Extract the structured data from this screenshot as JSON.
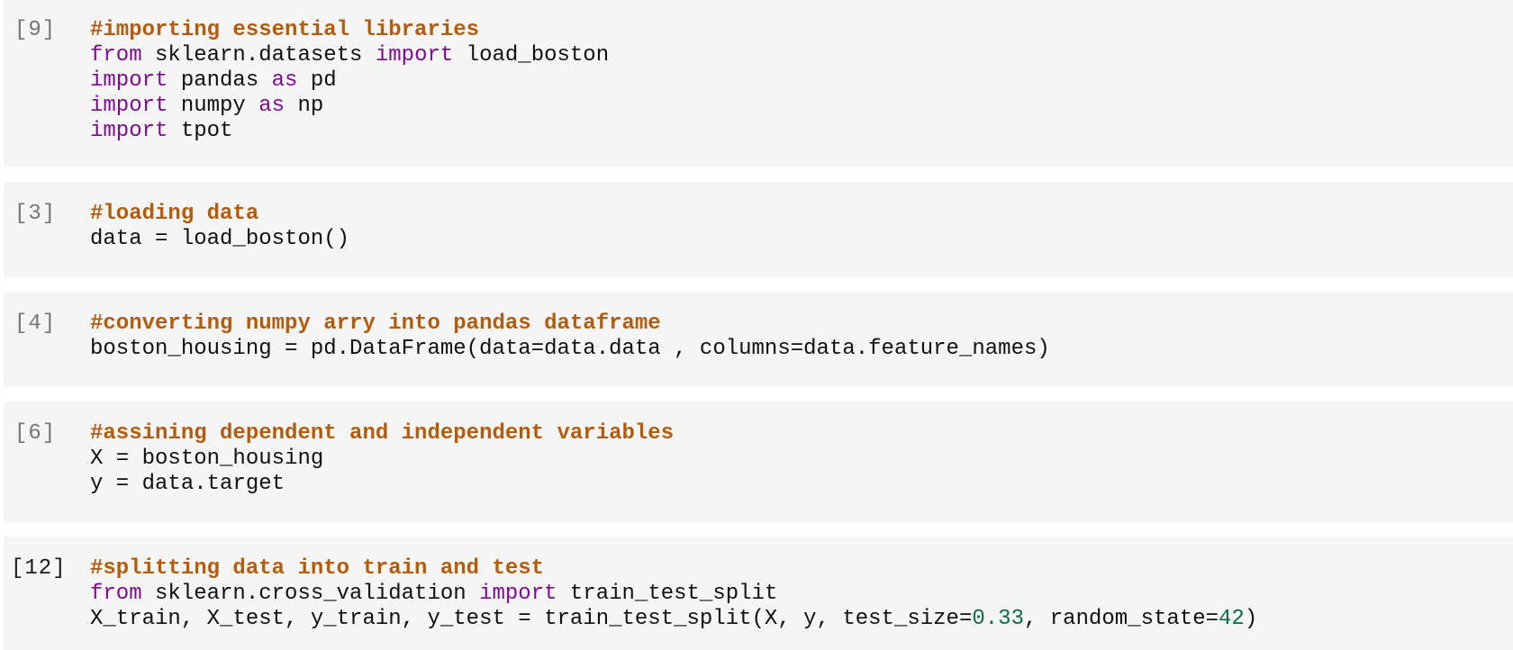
{
  "notebook": {
    "cells": [
      {
        "execution_count": "[9]",
        "active": false,
        "lines": [
          [
            {
              "t": "cm",
              "v": "#importing essential libraries"
            }
          ],
          [
            {
              "t": "kw",
              "v": "from"
            },
            {
              "t": "tx",
              "v": " sklearn.datasets "
            },
            {
              "t": "kw",
              "v": "import"
            },
            {
              "t": "tx",
              "v": " load_boston"
            }
          ],
          [
            {
              "t": "kw",
              "v": "import"
            },
            {
              "t": "tx",
              "v": " pandas "
            },
            {
              "t": "kw",
              "v": "as"
            },
            {
              "t": "tx",
              "v": " pd"
            }
          ],
          [
            {
              "t": "kw",
              "v": "import"
            },
            {
              "t": "tx",
              "v": " numpy "
            },
            {
              "t": "kw",
              "v": "as"
            },
            {
              "t": "tx",
              "v": " np"
            }
          ],
          [
            {
              "t": "kw",
              "v": "import"
            },
            {
              "t": "tx",
              "v": " tpot"
            }
          ]
        ]
      },
      {
        "execution_count": "[3]",
        "active": false,
        "lines": [
          [
            {
              "t": "cm",
              "v": "#loading data"
            }
          ],
          [
            {
              "t": "tx",
              "v": "data = load_boston()"
            }
          ]
        ]
      },
      {
        "execution_count": "[4]",
        "active": false,
        "lines": [
          [
            {
              "t": "cm",
              "v": "#converting numpy arry into pandas dataframe"
            }
          ],
          [
            {
              "t": "tx",
              "v": "boston_housing = pd.DataFrame(data=data.data , columns=data.feature_names)"
            }
          ]
        ]
      },
      {
        "execution_count": "[6]",
        "active": false,
        "lines": [
          [
            {
              "t": "cm",
              "v": "#assining dependent and independent variables"
            }
          ],
          [
            {
              "t": "tx",
              "v": "X = boston_housing"
            }
          ],
          [
            {
              "t": "tx",
              "v": "y = data.target"
            }
          ]
        ]
      },
      {
        "execution_count": "[12]",
        "active": true,
        "lines": [
          [
            {
              "t": "cm",
              "v": "#splitting data into train and test"
            }
          ],
          [
            {
              "t": "kw",
              "v": "from"
            },
            {
              "t": "tx",
              "v": " sklearn.cross_validation "
            },
            {
              "t": "kw",
              "v": "import"
            },
            {
              "t": "tx",
              "v": " train_test_split"
            }
          ],
          [
            {
              "t": "tx",
              "v": "X_train, X_test, y_train, y_test = train_test_split(X, y, test_size="
            },
            {
              "t": "num",
              "v": "0.33"
            },
            {
              "t": "tx",
              "v": ", random_state="
            },
            {
              "t": "num",
              "v": "42"
            },
            {
              "t": "tx",
              "v": ")"
            }
          ]
        ]
      }
    ]
  },
  "colors": {
    "cell_background": "#f5f5f5",
    "comment": "#b25c0e",
    "keyword": "#7d0c8f",
    "number": "#0d6b4a",
    "count_inactive": "#757575",
    "count_active": "#1a1a1a"
  }
}
